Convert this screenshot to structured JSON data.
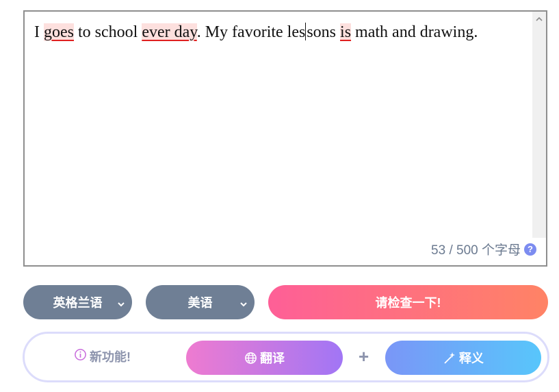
{
  "editor": {
    "segments": [
      {
        "text": "I ",
        "error": false
      },
      {
        "text": "goes",
        "error": true
      },
      {
        "text": " to school ",
        "error": false
      },
      {
        "text": "ever day",
        "error": true
      },
      {
        "text": ". My favorite les",
        "error": false
      },
      {
        "text": "sons ",
        "error": false
      },
      {
        "text": "is",
        "error": true
      },
      {
        "text": " math and drawing.",
        "error": false
      }
    ],
    "counter": "53 / 500 个字母",
    "help_icon_glyph": "?"
  },
  "controls": {
    "dialect1": "英格兰语",
    "dialect2": "美语",
    "check_button": "请检查一下!"
  },
  "features": {
    "new_feature": "新功能!",
    "translate": "翻译",
    "plus": "+",
    "define": "释义"
  },
  "colors": {
    "error_highlight": "#fde0de",
    "error_underline": "#e02020",
    "select_bg": "#6f7f95",
    "check_gradient": [
      "#fe5f97",
      "#ff8365"
    ],
    "translate_gradient": [
      "#ee7bd0",
      "#a176f5"
    ],
    "define_gradient": [
      "#7a96f7",
      "#58c6fb"
    ]
  }
}
